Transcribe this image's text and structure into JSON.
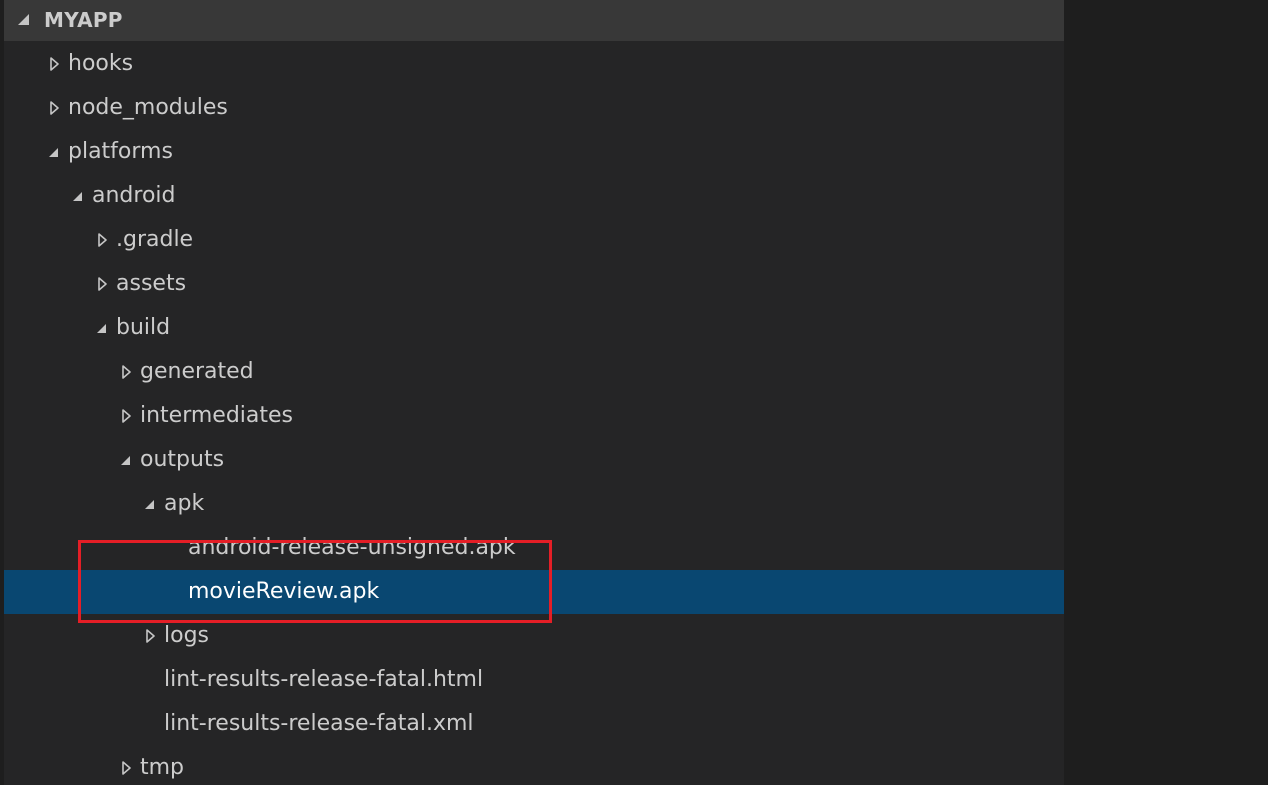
{
  "explorer": {
    "section_title": "MYAPP",
    "items": [
      {
        "label": "hooks",
        "expanded": false,
        "kind": "folder"
      },
      {
        "label": "node_modules",
        "expanded": false,
        "kind": "folder"
      },
      {
        "label": "platforms",
        "expanded": true,
        "kind": "folder"
      },
      {
        "label": "android",
        "expanded": true,
        "kind": "folder"
      },
      {
        "label": ".gradle",
        "expanded": false,
        "kind": "folder"
      },
      {
        "label": "assets",
        "expanded": false,
        "kind": "folder"
      },
      {
        "label": "build",
        "expanded": true,
        "kind": "folder"
      },
      {
        "label": "generated",
        "expanded": false,
        "kind": "folder"
      },
      {
        "label": "intermediates",
        "expanded": false,
        "kind": "folder"
      },
      {
        "label": "outputs",
        "expanded": true,
        "kind": "folder"
      },
      {
        "label": "apk",
        "expanded": true,
        "kind": "folder"
      },
      {
        "label": "android-release-unsigned.apk",
        "kind": "file"
      },
      {
        "label": "movieReview.apk",
        "kind": "file",
        "selected": true
      },
      {
        "label": "logs",
        "expanded": false,
        "kind": "folder"
      },
      {
        "label": "lint-results-release-fatal.html",
        "kind": "file"
      },
      {
        "label": "lint-results-release-fatal.xml",
        "kind": "file"
      },
      {
        "label": "tmp",
        "expanded": false,
        "kind": "folder"
      }
    ]
  },
  "colors": {
    "panel_bg": "#252526",
    "header_bg": "#383838",
    "editor_bg": "#1e1e1e",
    "selection_bg": "#094771",
    "text": "#cccccc",
    "highlight_box": "#e41e26"
  },
  "icons": {
    "collapsed": "chevron-right-outline-icon",
    "expanded": "chevron-down-filled-icon"
  }
}
